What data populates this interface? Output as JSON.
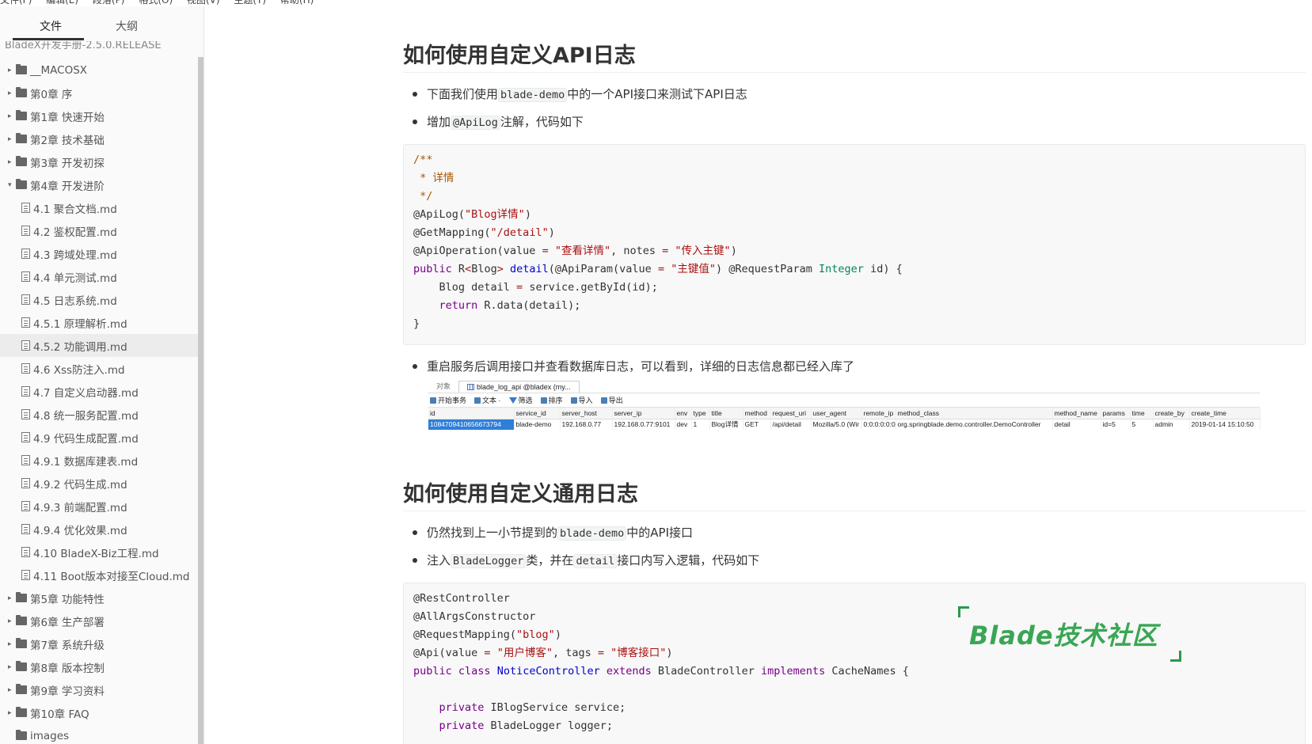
{
  "menubar": [
    "文件(F)",
    "编辑(E)",
    "段落(P)",
    "格式(O)",
    "视图(V)",
    "主题(T)",
    "帮助(H)"
  ],
  "sidebar": {
    "tabs": [
      "文件",
      "大纲"
    ],
    "root": "BladeX开发手册-2.5.0.RELEASE",
    "items": [
      {
        "label": "__MACOSX",
        "kind": "folder",
        "arrow": "▸"
      },
      {
        "label": "第0章 序",
        "kind": "folder",
        "arrow": "▸"
      },
      {
        "label": "第1章 快速开始",
        "kind": "folder",
        "arrow": "▸"
      },
      {
        "label": "第2章 技术基础",
        "kind": "folder",
        "arrow": "▸"
      },
      {
        "label": "第3章 开发初探",
        "kind": "folder",
        "arrow": "▸"
      },
      {
        "label": "第4章 开发进阶",
        "kind": "folder",
        "arrow": "▾"
      },
      {
        "label": "4.1 聚合文档.md",
        "kind": "file"
      },
      {
        "label": "4.2 鉴权配置.md",
        "kind": "file"
      },
      {
        "label": "4.3 跨域处理.md",
        "kind": "file"
      },
      {
        "label": "4.4 单元测试.md",
        "kind": "file"
      },
      {
        "label": "4.5 日志系统.md",
        "kind": "file"
      },
      {
        "label": "4.5.1 原理解析.md",
        "kind": "file"
      },
      {
        "label": "4.5.2 功能调用.md",
        "kind": "file",
        "selected": true
      },
      {
        "label": "4.6 Xss防注入.md",
        "kind": "file"
      },
      {
        "label": "4.7 自定义启动器.md",
        "kind": "file"
      },
      {
        "label": "4.8 统一服务配置.md",
        "kind": "file"
      },
      {
        "label": "4.9 代码生成配置.md",
        "kind": "file"
      },
      {
        "label": "4.9.1 数据库建表.md",
        "kind": "file"
      },
      {
        "label": "4.9.2 代码生成.md",
        "kind": "file"
      },
      {
        "label": "4.9.3 前端配置.md",
        "kind": "file"
      },
      {
        "label": "4.9.4 优化效果.md",
        "kind": "file"
      },
      {
        "label": "4.10 BladeX-Biz工程.md",
        "kind": "file"
      },
      {
        "label": "4.11 Boot版本对接至Cloud.md",
        "kind": "file"
      },
      {
        "label": "第5章 功能特性",
        "kind": "folder",
        "arrow": "▸"
      },
      {
        "label": "第6章 生产部署",
        "kind": "folder",
        "arrow": "▸"
      },
      {
        "label": "第7章 系统升级",
        "kind": "folder",
        "arrow": "▸"
      },
      {
        "label": "第8章 版本控制",
        "kind": "folder",
        "arrow": "▸"
      },
      {
        "label": "第9章 学习资料",
        "kind": "folder",
        "arrow": "▸"
      },
      {
        "label": "第10章 FAQ",
        "kind": "folder",
        "arrow": "▸"
      },
      {
        "label": "images",
        "kind": "plainfolder"
      }
    ]
  },
  "doc": {
    "h1": "如何使用自定义API日志",
    "s1_b1": [
      "下面我们使用",
      "blade-demo",
      "中的一个API接口来测试下API日志"
    ],
    "s1_b2": [
      "增加",
      "@ApiLog",
      "注解，代码如下"
    ],
    "code1": {
      "l1": "/**",
      "l2": " * 详情",
      "l3": " */",
      "l4a": "@ApiLog(",
      "l4s": "\"Blog详情\"",
      "l4b": ")",
      "l5a": "@GetMapping(",
      "l5s": "\"/detail\"",
      "l5b": ")",
      "l6a": "@ApiOperation(value ",
      "l6eq1": "=",
      "l6s1": "\"查看详情\"",
      "l6m": ", notes ",
      "l6eq2": "=",
      "l6s2": "\"传入主键\"",
      "l6b": ")",
      "l7kw": "public",
      "l7a": " R",
      "l7lt": "<",
      "l7t": "Blog",
      "l7gt": ">",
      "l7def": "detail",
      "l7b": "(@ApiParam(value ",
      "l7eq": "=",
      "l7s": "\"主键值\"",
      "l7c": ") @RequestParam ",
      "l7type": "Integer",
      "l7d": " id) {",
      "l8a": "    Blog detail ",
      "l8eq": "=",
      "l8b": " service.getById(id);",
      "l9kw": "return",
      "l9b": " R.data(detail);",
      "l10": "}"
    },
    "s1_b3": "重启服务后调用接口并查看数据库日志，可以看到，详细的日志信息都已经入库了",
    "db": {
      "tab1": "对象",
      "tab2": "blade_log_api @bladex (my...",
      "toolbar": [
        "开始事务",
        "文本 ·",
        "筛选",
        "排序",
        "导入",
        "导出"
      ],
      "columns": [
        "id",
        "service_id",
        "server_host",
        "server_ip",
        "env",
        "type",
        "title",
        "method",
        "request_uri",
        "user_agent",
        "remote_ip",
        "method_class",
        "method_name",
        "params",
        "time",
        "create_by",
        "create_time"
      ],
      "row": [
        "1084709410656673794",
        "blade-demo",
        "192.168.0.77",
        "192.168.0.77:9101",
        "dev",
        "1",
        "Blog详情",
        "GET",
        "/api/detail",
        "Mozilla/5.0 (Wir",
        "0:0:0:0:0:0:0:1",
        "org.springblade.demo.controller.DemoController",
        "detail",
        "id=5",
        "5",
        "admin",
        "2019-01-14 15:10:50"
      ]
    },
    "h2": "如何使用自定义通用日志",
    "s2_b1": [
      "仍然找到上一小节提到的",
      "blade-demo",
      "中的API接口"
    ],
    "s2_b2": [
      "注入",
      "BladeLogger",
      "类，并在",
      "detail",
      "接口内写入逻辑，代码如下"
    ],
    "code2": {
      "l1": "@RestController",
      "l2": "@AllArgsConstructor",
      "l3a": "@RequestMapping(",
      "l3s": "\"blog\"",
      "l3b": ")",
      "l4a": "@Api(value ",
      "l4eq1": "=",
      "l4s1": "\"用户博客\"",
      "l4m": ", tags ",
      "l4eq2": "=",
      "l4s2": "\"博客接口\"",
      "l4b": ")",
      "l5kw1": "public",
      "l5kw2": "class",
      "l5def": "NoticeController",
      "l5kw3": "extends",
      "l5a": " BladeController ",
      "l5kw4": "implements",
      "l5b": " CacheNames {",
      "l7kw": "private",
      "l7b": " IBlogService service;",
      "l8kw": "private",
      "l8b": " BladeLogger logger;"
    }
  },
  "watermark": "Blade技术社区",
  "colors": {
    "accent": "#3aa655",
    "selection": "#2f7fd8"
  }
}
